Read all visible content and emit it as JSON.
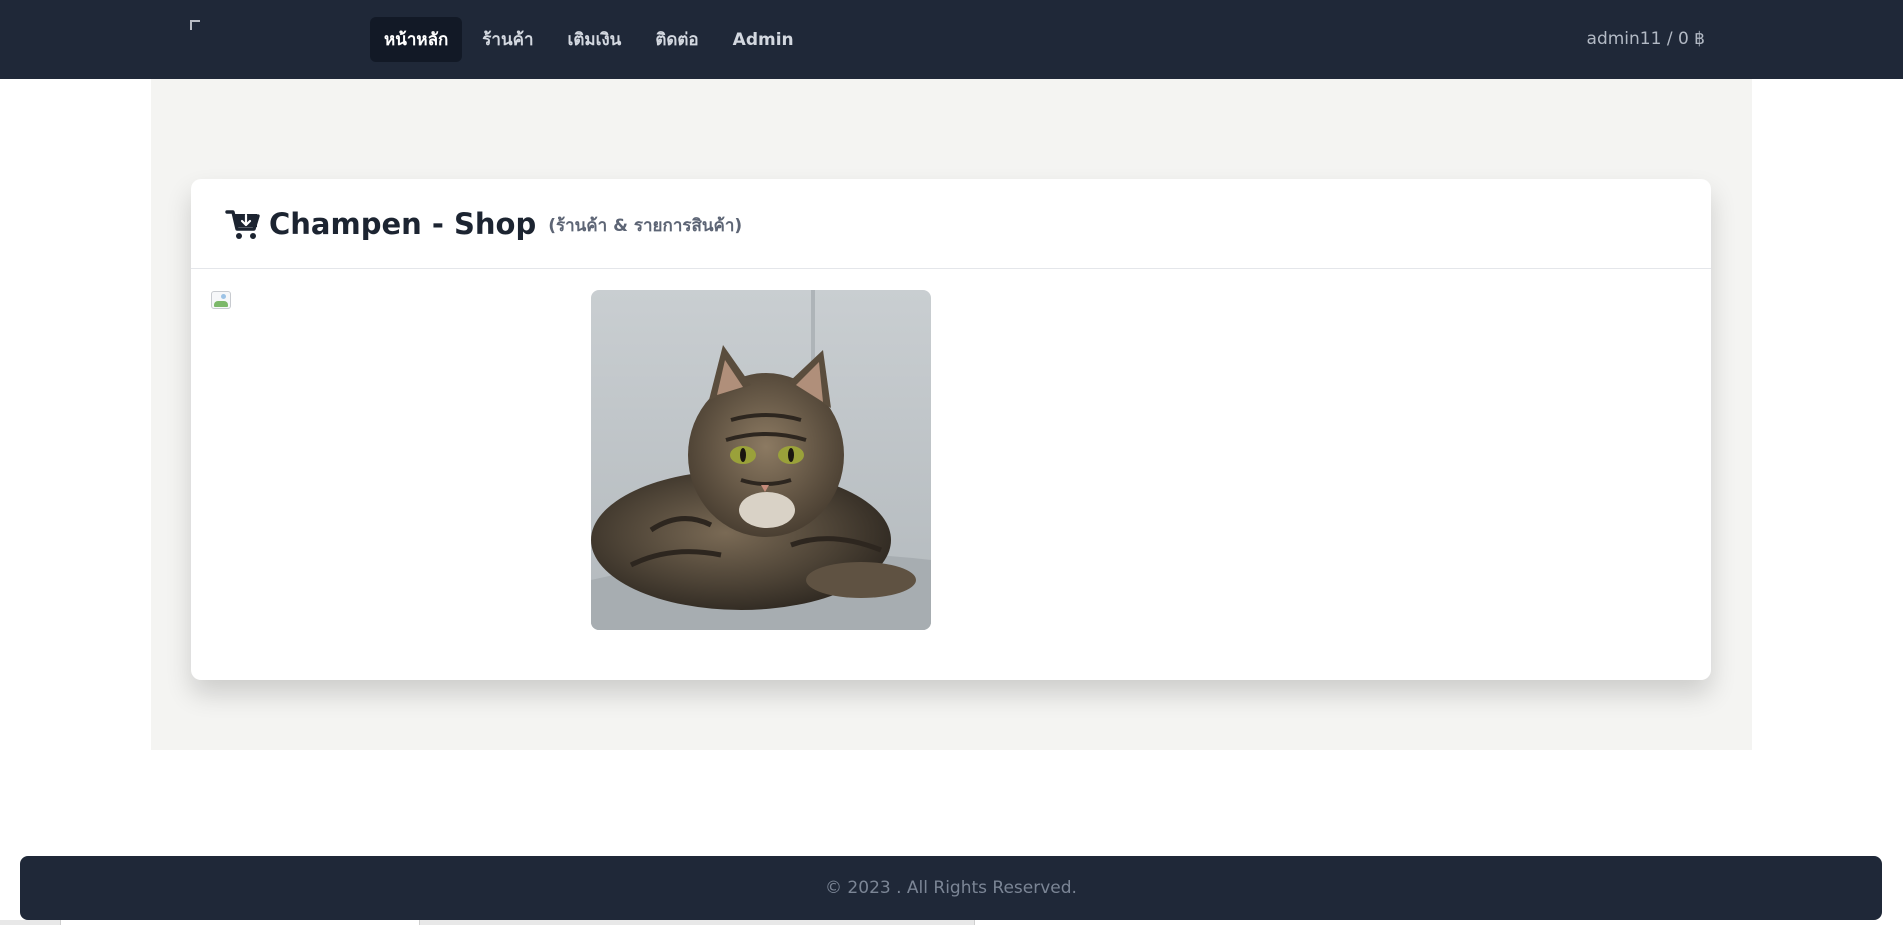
{
  "navbar": {
    "items": [
      {
        "label": "หน้าหลัก",
        "active": true
      },
      {
        "label": "ร้านค้า",
        "active": false
      },
      {
        "label": "เติมเงิน",
        "active": false
      },
      {
        "label": "ติดต่อ",
        "active": false
      },
      {
        "label": "Admin",
        "active": false
      }
    ],
    "user_balance": "admin11 / 0 ฿"
  },
  "shop": {
    "title": "Champen - Shop",
    "subtitle": "(ร้านค้า & รายการสินค้า)",
    "icon": "cart-icon",
    "product_image": "cat-photo"
  },
  "footer": {
    "copyright": "© 2023 . All Rights Reserved."
  },
  "colors": {
    "navbar_bg": "#1f2838",
    "active_nav_bg": "#121926",
    "panel_bg": "#f4f4f2",
    "title_text": "#1c2431"
  }
}
